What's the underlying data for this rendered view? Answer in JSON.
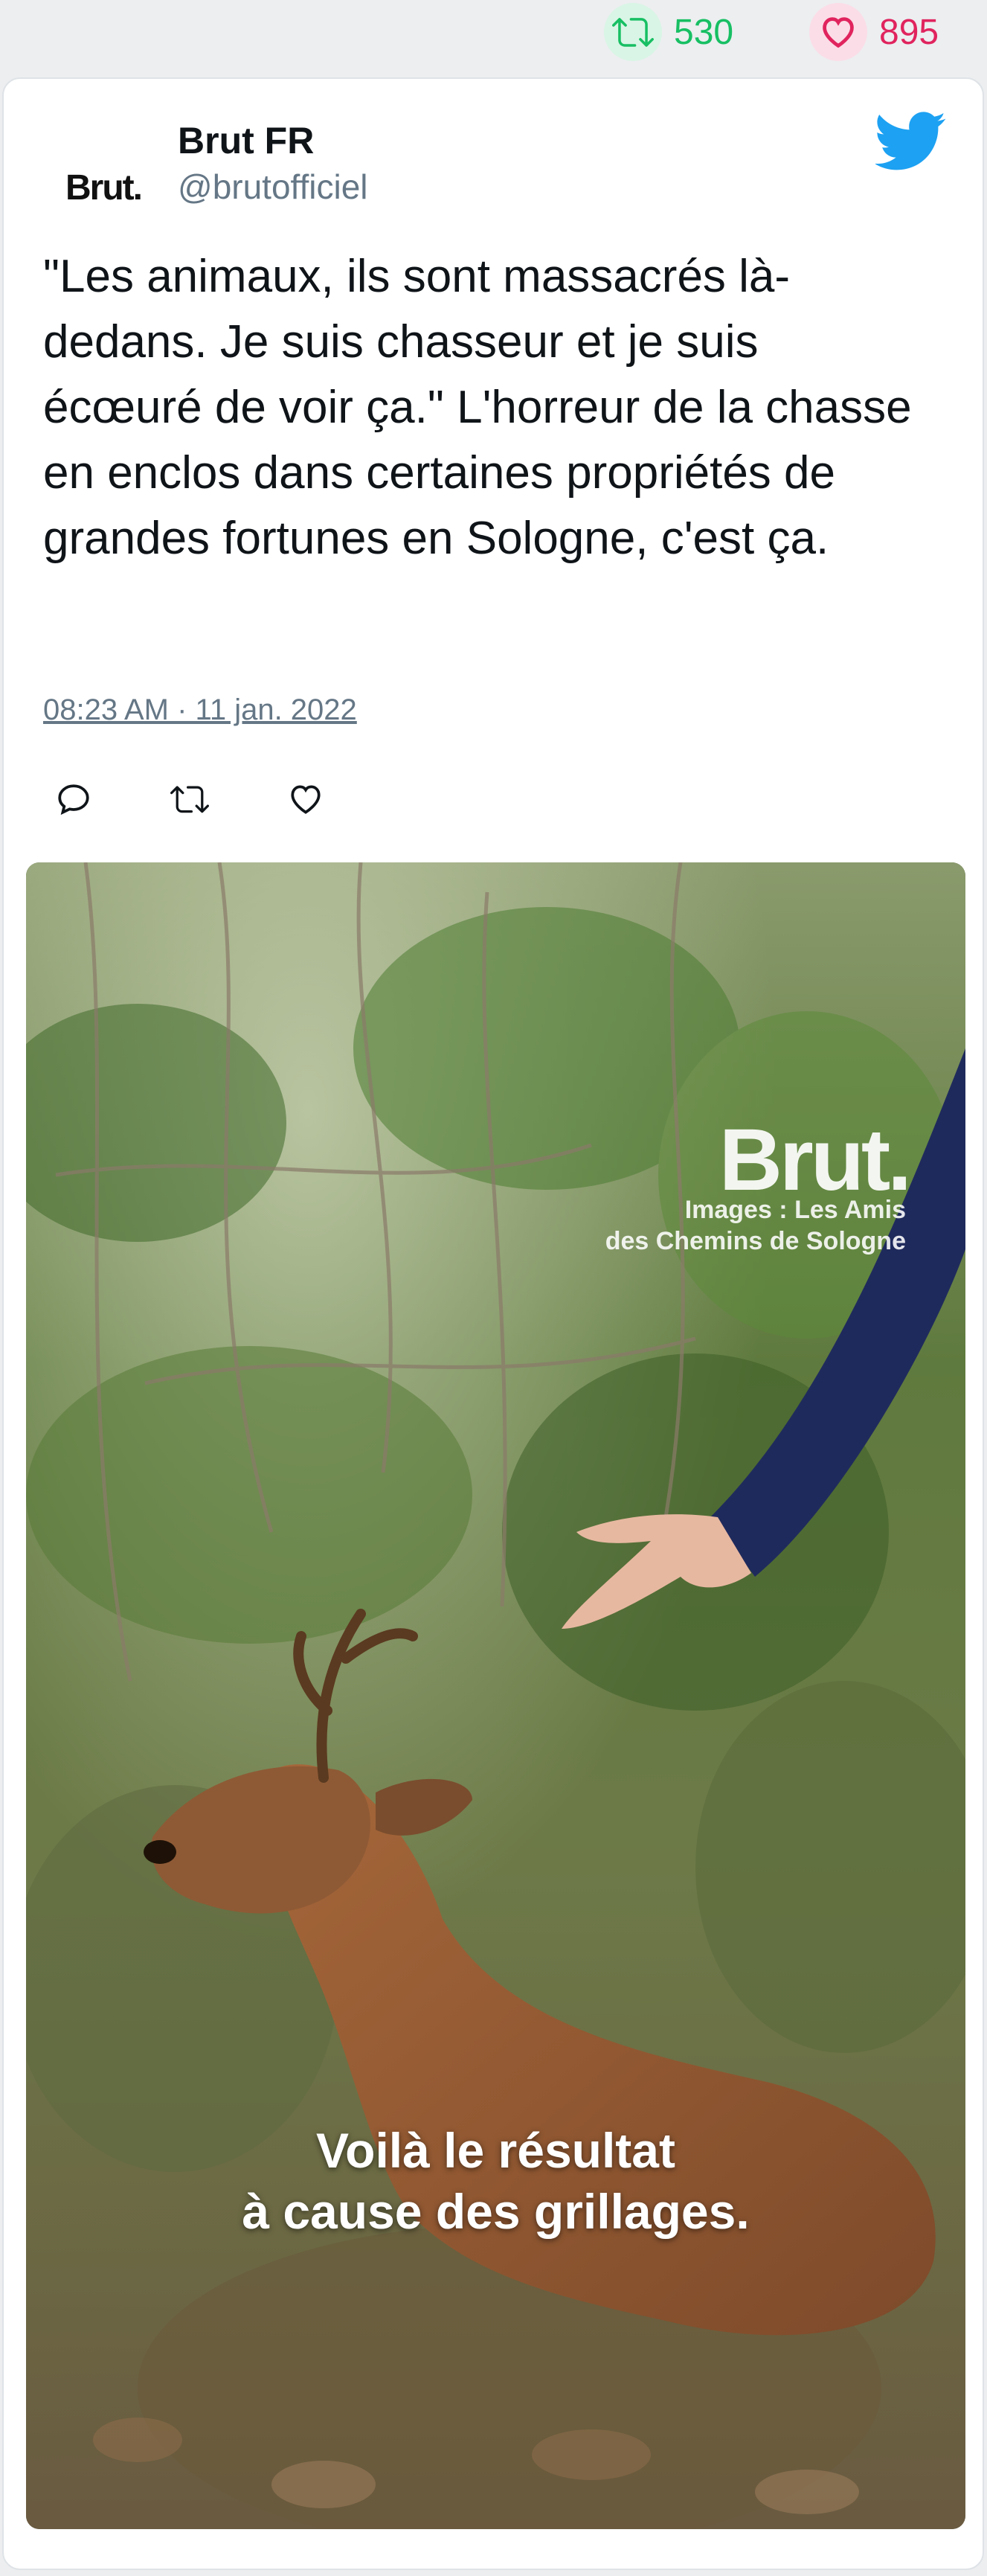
{
  "stats": {
    "retweets": "530",
    "likes": "895"
  },
  "author": {
    "avatar_text": "Brut.",
    "name": "Brut FR",
    "handle": "@brutofficiel"
  },
  "tweet": {
    "text": "\"Les animaux, ils sont massacrés là-dedans. Je suis chasseur et je suis écœuré de voir ça.\" L'horreur de la chasse en enclos dans certaines propriétés de grandes fortunes en Sologne, c'est ça.",
    "timestamp": "08:23 AM · 11 jan. 2022"
  },
  "media": {
    "logo": "Brut.",
    "credit_line1": "Images : Les Amis",
    "credit_line2": "des Chemins de Sologne",
    "caption_line1": "Voilà le résultat",
    "caption_line2": "à cause des grillages."
  },
  "icons": {
    "retweet": "retweet-icon",
    "like": "heart-icon",
    "reply": "reply-icon",
    "brand": "twitter-bird-icon"
  },
  "colors": {
    "retweet": "#17bf63",
    "like": "#e0245e",
    "twitter_blue": "#1da1f2",
    "muted": "#657786"
  }
}
